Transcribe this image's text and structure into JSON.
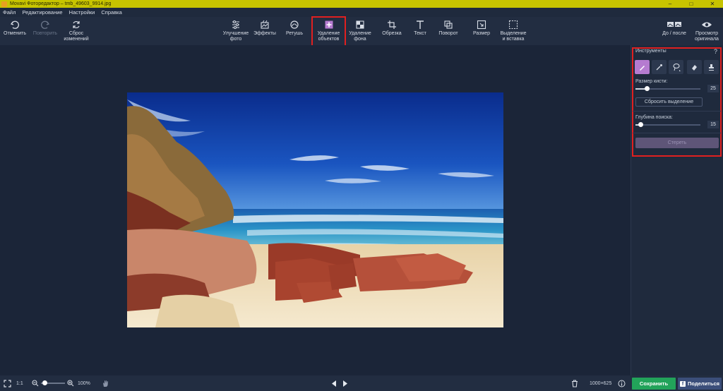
{
  "window": {
    "title": "Movavi Фоторедактор – tmb_49603_9914.jpg",
    "min": "–",
    "max": "□",
    "close": "✕"
  },
  "menu": [
    "Файл",
    "Редактирование",
    "Настройки",
    "Справка"
  ],
  "toolbar": {
    "undo": "Отменить",
    "redo": "Повторить",
    "reset": "Сброс\nизменений",
    "enhance": "Улучшение\nфото",
    "effects": "Эффекты",
    "retouch": "Ретушь",
    "object_removal": "Удаление\nобъектов",
    "bg_removal": "Удаление\nфона",
    "crop": "Обрезка",
    "text": "Текст",
    "rotate": "Поворот",
    "resize": "Размер",
    "select_paste": "Выделение\nи вставка",
    "before_after": "До / после",
    "view_original": "Просмотр\nоригинала"
  },
  "panel": {
    "title": "Инструменты",
    "help": "?",
    "brush_size_label": "Размер кисти:",
    "brush_size": 25,
    "reset_selection": "Сбросить выделение",
    "search_depth_label": "Глубина поиска:",
    "search_depth": 15,
    "erase": "Стереть"
  },
  "status": {
    "fit": "1:1",
    "zoom": "100%",
    "dimensions": "1000×625",
    "save": "Сохранить",
    "share": "Поделиться",
    "fb": "f"
  },
  "colors": {
    "accent_purple": "#b57bd0",
    "save_green": "#22a35a",
    "highlight_red": "#e02020"
  }
}
